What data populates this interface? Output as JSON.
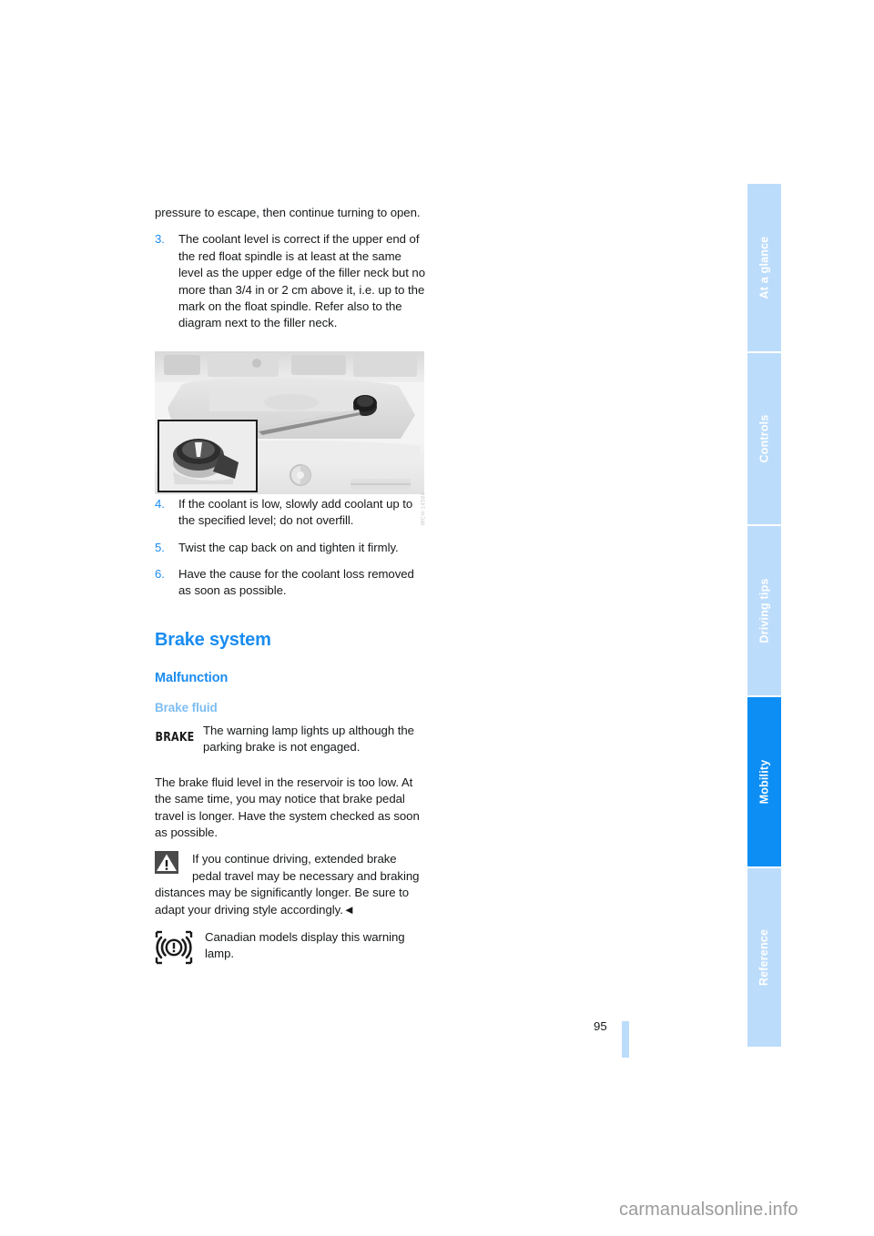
{
  "document": {
    "page_number": "95",
    "watermark": "carmanualsonline.info"
  },
  "sidebar": {
    "tabs": [
      {
        "label": "At a glance",
        "active": false
      },
      {
        "label": "Controls",
        "active": false
      },
      {
        "label": "Driving tips",
        "active": false
      },
      {
        "label": "Mobility",
        "active": true
      },
      {
        "label": "Reference",
        "active": false
      }
    ]
  },
  "content": {
    "continued_paragraph": "pressure to escape, then continue turning to open.",
    "steps": [
      {
        "number": "3.",
        "text": "The coolant level is correct if the upper end of the red float spindle is at least at the same level as the upper edge of the filler neck but no more than 3/4 in or 2 cm above it, i.e. up to the mark on the float spindle. Refer also to the diagram next to the filler neck."
      },
      {
        "number": "4.",
        "text": "If the coolant is low, slowly add coolant up to the specified level; do not overfill."
      },
      {
        "number": "5.",
        "text": "Twist the cap back on and tighten it firmly."
      },
      {
        "number": "6.",
        "text": "Have the cause for the coolant loss removed as soon as possible."
      }
    ],
    "figure": {
      "caption_code": "WCH-1458k",
      "alt": "Engine bay showing coolant expansion tank cap with inset detail of cap"
    },
    "heading_1": "Brake system",
    "heading_2": "Malfunction",
    "heading_3": "Brake fluid",
    "brake_lamp_label": "BRAKE",
    "brake_lamp_text": "The warning lamp lights up although the parking brake is not engaged.",
    "body_paragraph": "The brake fluid level in the reservoir is too low. At the same time, you may notice that brake pedal travel is longer. Have the system checked as soon as possible.",
    "warning_text": "If you continue driving, extended brake pedal travel may be necessary and braking distances may be significantly longer. Be sure to adapt your driving style accordingly.",
    "warning_end_marker": "◄",
    "canadian_text": "Canadian models display this warning lamp."
  },
  "colors": {
    "accent_blue": "#1a8cf0",
    "tab_blue": "#bcdcfb",
    "tab_active_blue": "#0d8ef5",
    "subheading_light_blue": "#7dbdf2",
    "body_text": "#16181a"
  }
}
